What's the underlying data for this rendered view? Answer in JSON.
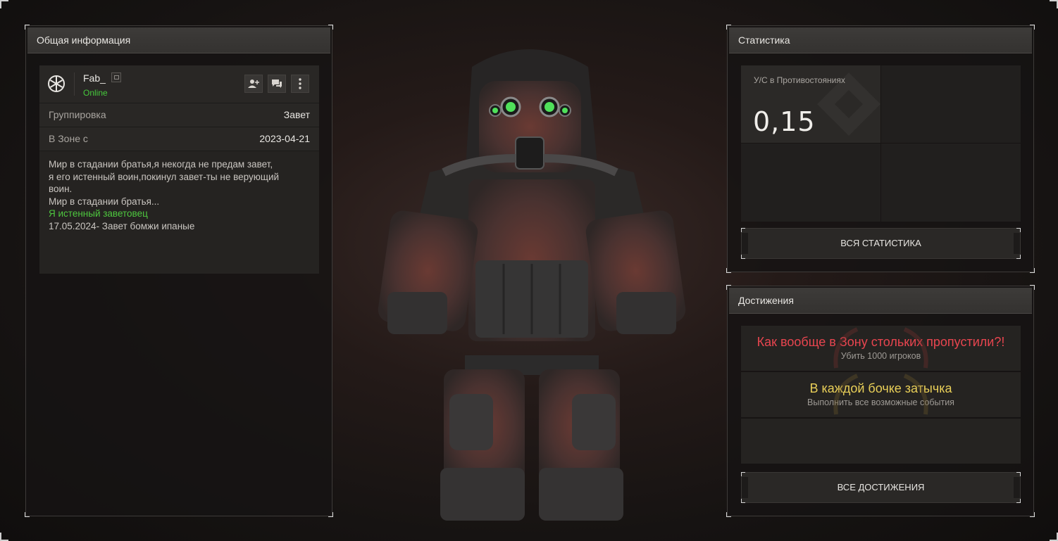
{
  "general": {
    "header": "Общая информация",
    "username": "Fab_",
    "status": "Online",
    "faction_label": "Группировка",
    "faction_value": "Завет",
    "zone_since_label": "В Зоне с",
    "zone_since_value": "2023-04-21",
    "bio_lines": [
      {
        "text": "Мир в стадании братья,я некогда не предам завет,",
        "green": false
      },
      {
        "text": "я его истенный воин,покинул завет-ты не верующий",
        "green": false
      },
      {
        "text": "воин.",
        "green": false
      },
      {
        "text": "Мир в стадании братья...",
        "green": false
      },
      {
        "text": "Я истенный заветовец",
        "green": true
      },
      {
        "text": "17.05.2024- Завет бомжи ипаные",
        "green": false
      }
    ]
  },
  "stats": {
    "header": "Статистика",
    "kd_label": "У/С в Противостояниях",
    "kd_value": "0,15",
    "all_button": "ВСЯ СТАТИСТИКА"
  },
  "achievements": {
    "header": "Достижения",
    "items": [
      {
        "title": "Как вообще в Зону стольких пропустили?!",
        "desc": "Убить 1000 игроков",
        "color": "#e8454f"
      },
      {
        "title": "В каждой бочке затычка",
        "desc": "Выполнить все возможные события",
        "color": "#e9cf58"
      }
    ],
    "all_button": "ВСЕ ДОСТИЖЕНИЯ"
  },
  "icons": {
    "faction": "snowflake-icon",
    "copy": "copy-icon",
    "add_friend": "add-friend-icon",
    "message": "message-icon",
    "more": "more-vertical-icon"
  },
  "colors": {
    "online": "#46c93c",
    "bio_highlight": "#4ec83f"
  }
}
